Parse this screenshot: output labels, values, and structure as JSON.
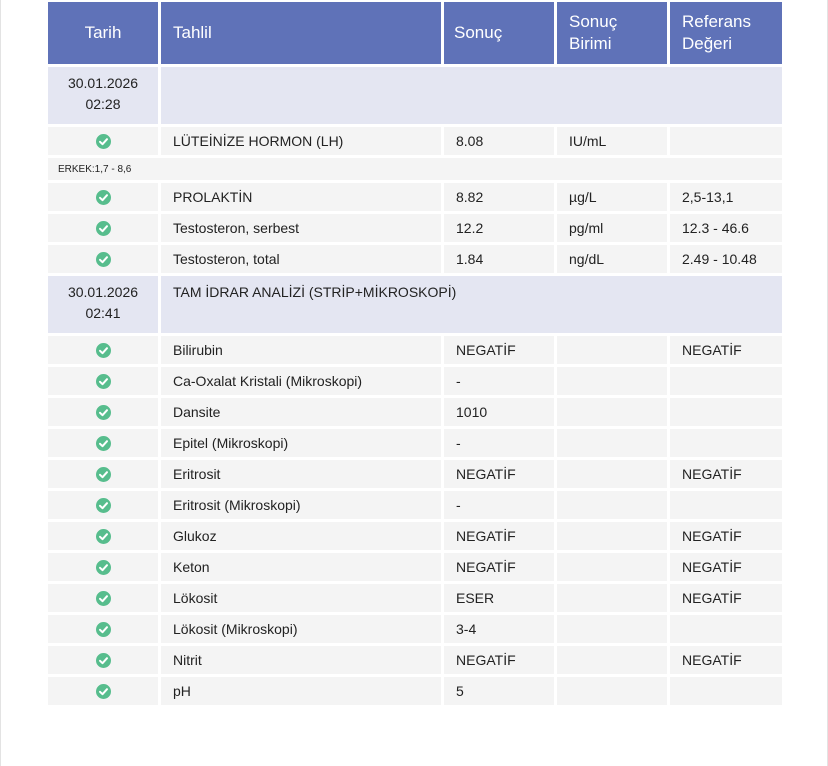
{
  "columns": {
    "date": "Tarih",
    "test": "Tahlil",
    "result": "Sonuç",
    "unit": "Sonuç Birimi",
    "reference": "Referans Değeri"
  },
  "groups": [
    {
      "date": "30.01.2026",
      "time": "02:28",
      "title": "",
      "rows": [
        {
          "test": "LÜTEİNİZE HORMON (LH)",
          "result": "8.08",
          "unit": "IU/mL",
          "reference": "",
          "note": "ERKEK:1,7 - 8,6"
        },
        {
          "test": "PROLAKTİN",
          "result": "8.82",
          "unit": "µg/L",
          "reference": "2,5-13,1"
        },
        {
          "test": "Testosteron, serbest",
          "result": "12.2",
          "unit": "pg/ml",
          "reference": "12.3 - 46.6"
        },
        {
          "test": "Testosteron, total",
          "result": "1.84",
          "unit": "ng/dL",
          "reference": "2.49 - 10.48"
        }
      ]
    },
    {
      "date": "30.01.2026",
      "time": "02:41",
      "title": "TAM İDRAR ANALİZİ (STRİP+MİKROSKOPİ)",
      "rows": [
        {
          "test": "Bilirubin",
          "result": "NEGATİF",
          "unit": "",
          "reference": "NEGATİF"
        },
        {
          "test": "Ca-Oxalat Kristali (Mikroskopi)",
          "result": "-",
          "unit": "",
          "reference": ""
        },
        {
          "test": "Dansite",
          "result": "1010",
          "unit": "",
          "reference": ""
        },
        {
          "test": "Epitel (Mikroskopi)",
          "result": "-",
          "unit": "",
          "reference": ""
        },
        {
          "test": "Eritrosit",
          "result": "NEGATİF",
          "unit": "",
          "reference": "NEGATİF"
        },
        {
          "test": "Eritrosit (Mikroskopi)",
          "result": "-",
          "unit": "",
          "reference": ""
        },
        {
          "test": "Glukoz",
          "result": "NEGATİF",
          "unit": "",
          "reference": "NEGATİF"
        },
        {
          "test": "Keton",
          "result": "NEGATİF",
          "unit": "",
          "reference": "NEGATİF"
        },
        {
          "test": "Lökosit",
          "result": "ESER",
          "unit": "",
          "reference": "NEGATİF"
        },
        {
          "test": "Lökosit (Mikroskopi)",
          "result": "3-4",
          "unit": "",
          "reference": ""
        },
        {
          "test": "Nitrit",
          "result": "NEGATİF",
          "unit": "",
          "reference": "NEGATİF"
        },
        {
          "test": "pH",
          "result": "5",
          "unit": "",
          "reference": ""
        }
      ]
    }
  ],
  "colors": {
    "header_bg": "#5f72b8",
    "group_bg": "#e4e6f2",
    "row_bg": "#f4f4f4",
    "check_green": "#57bd8d"
  },
  "icons": {
    "status": "check-circle-icon"
  }
}
